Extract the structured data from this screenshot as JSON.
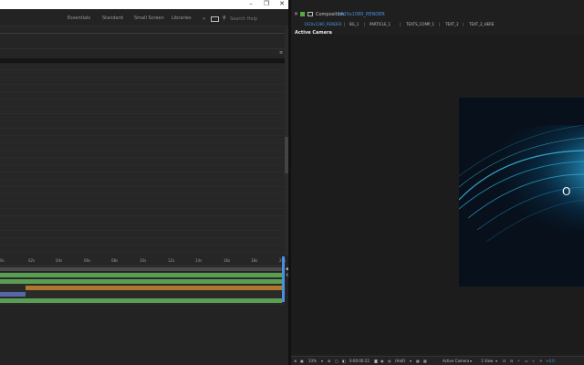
{
  "left_window": {
    "controls": {
      "minimize": "–",
      "maximize": "❐",
      "close": "✕"
    },
    "workspaces": [
      "Essentials",
      "Standard",
      "Small Screen",
      "Libraries"
    ],
    "overflow": "»",
    "search": {
      "placeholder": "Search Help"
    },
    "panel_close": "≡"
  },
  "timeline": {
    "ticks": [
      "0s",
      "02s",
      "04s",
      "06s",
      "08s",
      "10s",
      "12s",
      "14s",
      "16s",
      "18s",
      "20s"
    ],
    "layers": [
      {
        "color": "#5a9e54",
        "start": 0.0,
        "end": 1.0
      },
      {
        "color": "#5a9e54",
        "start": 0.0,
        "end": 1.0
      },
      {
        "color": "#b2762c",
        "start": 0.09,
        "end": 1.0
      },
      {
        "color": "#5667a8",
        "start": 0.0,
        "end": 0.09
      },
      {
        "color": "#5a9e54",
        "start": 0.0,
        "end": 0.99
      }
    ]
  },
  "comp_panel": {
    "close": "✕",
    "title_label": "Composition",
    "title_name": "1920x1080_RENDER",
    "tabs": [
      {
        "label": "1920x1080_RENDER",
        "active": true
      },
      {
        "label": "BG_1",
        "active": false
      },
      {
        "label": "PARTICLE_1",
        "active": false
      },
      {
        "label": "TEXTS_COMP_1",
        "active": false
      },
      {
        "label": "TEXT_2",
        "active": false
      },
      {
        "label": "TEXT_2_HERE",
        "active": false
      }
    ],
    "tab_separator": "|",
    "camera_label": "Active Camera",
    "canvas_letter": "O"
  },
  "viewer_bar": {
    "zoom": "33%",
    "timecode": "0:00:00:22",
    "resolution": "(Half)",
    "camera": "Active Camera",
    "views": "1 View",
    "exposure": "+0.0"
  },
  "colors": {
    "accent_blue": "#4a90e2",
    "green_label": "#5a9e54",
    "orange_label": "#b2762c",
    "purple_label": "#5667a8"
  }
}
